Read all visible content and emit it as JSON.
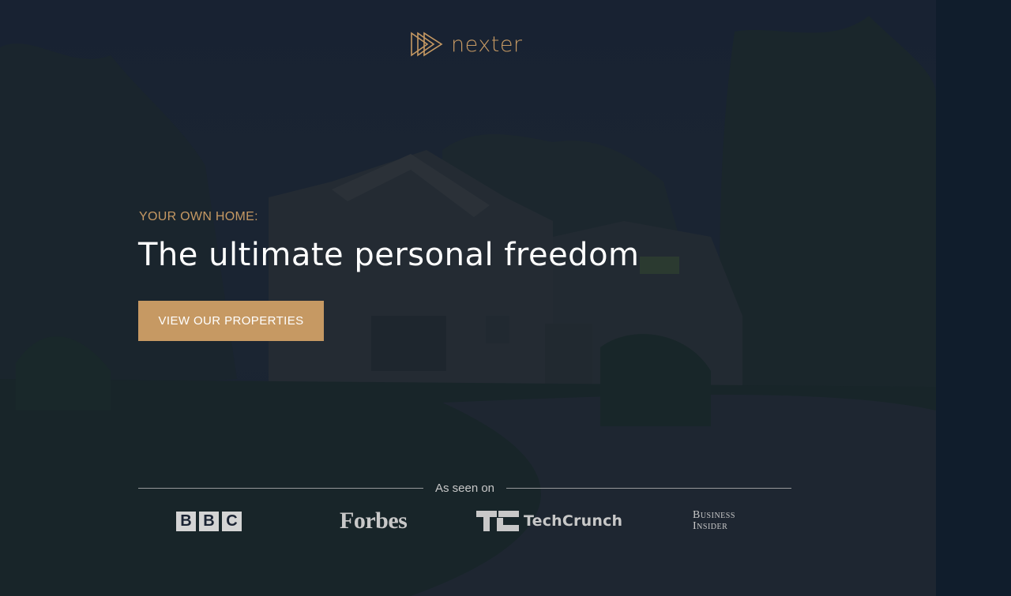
{
  "brand": {
    "name": "nexter",
    "accent_color": "#c69963",
    "icon": "triple-play-triangle-icon"
  },
  "hero": {
    "background": "house-at-dusk-photo",
    "subtitle": "YOUR OWN HOME:",
    "title": "The ultimate personal freedom",
    "cta_label": "VIEW OUR PROPERTIES"
  },
  "press": {
    "label": "As seen on",
    "logos": [
      {
        "name": "BBC",
        "letters": [
          "B",
          "B",
          "C"
        ]
      },
      {
        "name": "Forbes",
        "text": "Forbes"
      },
      {
        "name": "TechCrunch",
        "text": "TechCrunch"
      },
      {
        "name": "Business Insider",
        "lines": [
          "Business",
          "Insider"
        ]
      }
    ]
  },
  "colors": {
    "navy": "#101d2c",
    "gold": "#c69963",
    "white": "#ffffff"
  }
}
